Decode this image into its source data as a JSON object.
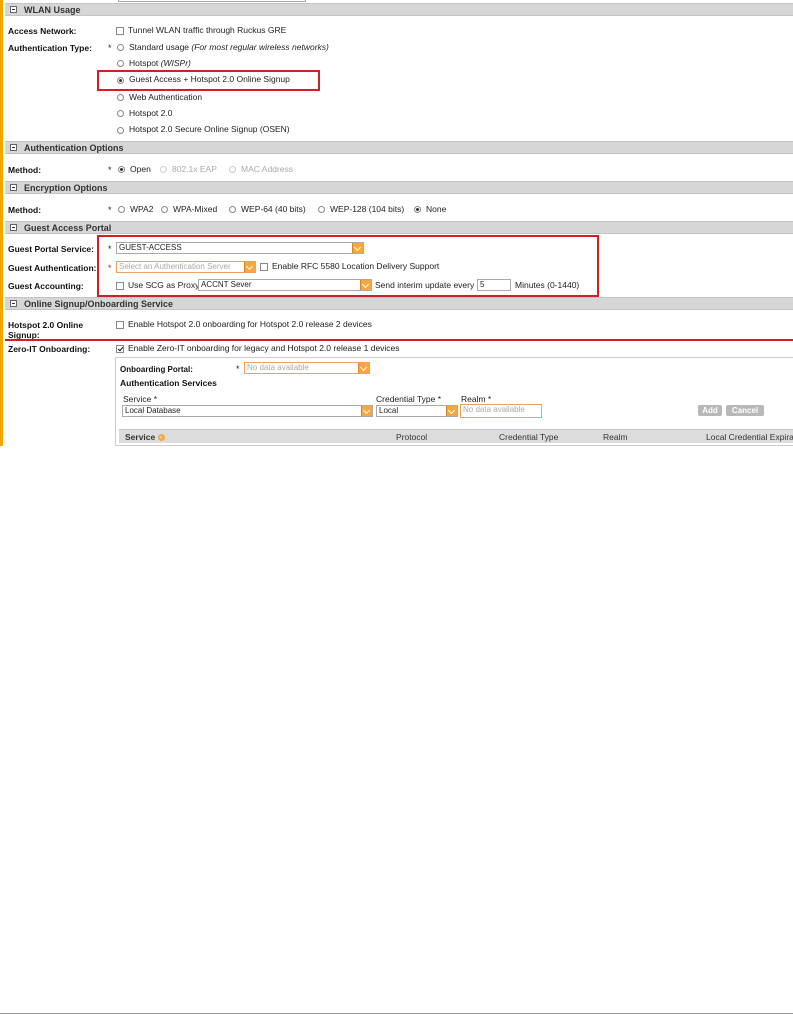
{
  "sections": {
    "wlan_usage": "WLAN Usage",
    "auth_options": "Authentication Options",
    "encryption_options": "Encryption Options",
    "guest_access_portal": "Guest Access Portal",
    "online_signup": "Online Signup/Onboarding Service"
  },
  "wlan_usage": {
    "access_network_label": "Access Network:",
    "tunnel_label": "Tunnel WLAN traffic through Ruckus GRE",
    "auth_type_label": "Authentication Type:",
    "options": [
      {
        "label": "Standard usage",
        "hint": "(For most regular wireless networks)"
      },
      {
        "label": "Hotspot",
        "hint": "(WISPr)"
      },
      {
        "label": "Guest Access + Hotspot 2.0 Online Signup",
        "hint": ""
      },
      {
        "label": "Web Authentication",
        "hint": ""
      },
      {
        "label": "Hotspot 2.0",
        "hint": ""
      },
      {
        "label": "Hotspot 2.0 Secure Online Signup (OSEN)",
        "hint": ""
      }
    ]
  },
  "auth_options": {
    "method_label": "Method:",
    "options": [
      "Open",
      "802.1x EAP",
      "MAC Address"
    ]
  },
  "encryption": {
    "method_label": "Method:",
    "options": [
      "WPA2",
      "WPA-Mixed",
      "WEP-64 (40 bits)",
      "WEP-128 (104 bits)",
      "None"
    ]
  },
  "guest_portal": {
    "service_label": "Guest Portal Service:",
    "service_value": "GUEST-ACCESS",
    "auth_label": "Guest Authentication:",
    "auth_placeholder": "Select an Authentication Server",
    "rfc_label": "Enable RFC 5580 Location Delivery Support",
    "accounting_label": "Guest Accounting:",
    "proxy_label": "Use SCG as Proxy",
    "accounting_value": "ACCNT Sever",
    "interim_label": "Send interim update every",
    "interim_value": "5",
    "minutes_label": "Minutes (0-1440)"
  },
  "online_signup": {
    "hs20_label_line1": "Hotspot 2.0 Online",
    "hs20_label_line2": "Signup:",
    "hs20_checkbox_label": "Enable Hotspot 2.0 onboarding for Hotspot 2.0 release 2 devices",
    "zeroit_label": "Zero-IT Onboarding:",
    "zeroit_checkbox_label": "Enable Zero-IT onboarding for legacy and Hotspot 2.0 release 1 devices",
    "portal_label": "Onboarding Portal:",
    "portal_placeholder": "No data available",
    "auth_services_title": "Authentication Services",
    "service_col": "Service *",
    "service_value": "Local Database",
    "cred_col": "Credential Type *",
    "cred_value": "Local",
    "realm_col": "Realm *",
    "realm_placeholder": "No data available",
    "add_button": "Add",
    "cancel_button": "Cancel",
    "table_headers": [
      "Service",
      "Protocol",
      "Credential Type",
      "Realm",
      "Local Credential Expira"
    ]
  },
  "required_mark": "*",
  "colors": {
    "accent": "#f7a740",
    "highlight": "#d21f26",
    "section_bg": "#d6d6d6"
  }
}
